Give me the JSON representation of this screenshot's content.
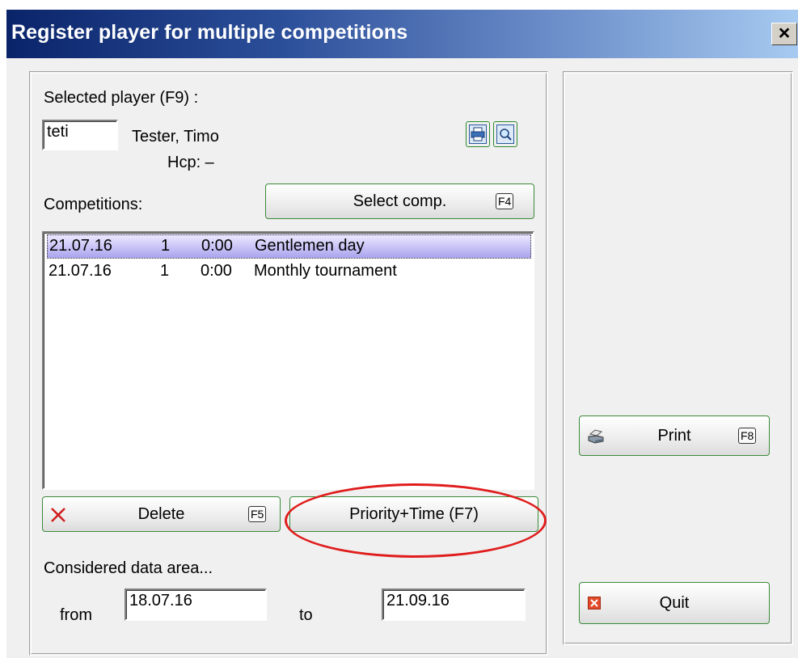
{
  "window": {
    "title": "Register player for multiple competitions",
    "close_label": "×"
  },
  "player": {
    "section_label": "Selected player (F9) :",
    "code": "teti",
    "name": "Tester, Timo",
    "hcp": "Hcp: –"
  },
  "competitions": {
    "label": "Competitions:",
    "select_button": "Select comp.",
    "select_fkey": "F4",
    "rows": [
      {
        "date": "21.07.16",
        "num": "1",
        "time": "0:00",
        "name": "Gentlemen day",
        "selected": true
      },
      {
        "date": "21.07.16",
        "num": "1",
        "time": "0:00",
        "name": "Monthly tournament",
        "selected": false
      }
    ]
  },
  "actions": {
    "delete_label": "Delete",
    "delete_fkey": "F5",
    "priority_label": "Priority+Time (F7)",
    "print_label": "Print",
    "print_fkey": "F8",
    "quit_label": "Quit"
  },
  "data_area": {
    "label": "Considered data area...",
    "from_label": "from",
    "from_value": "18.07.16",
    "to_label": "to",
    "to_value": "21.09.16"
  },
  "colors": {
    "title_start": "#0a246a",
    "title_end": "#a6caf0",
    "button_border": "#3a8a3a",
    "highlight_ellipse": "#e01d1d",
    "selection": "#a9a3ee"
  }
}
